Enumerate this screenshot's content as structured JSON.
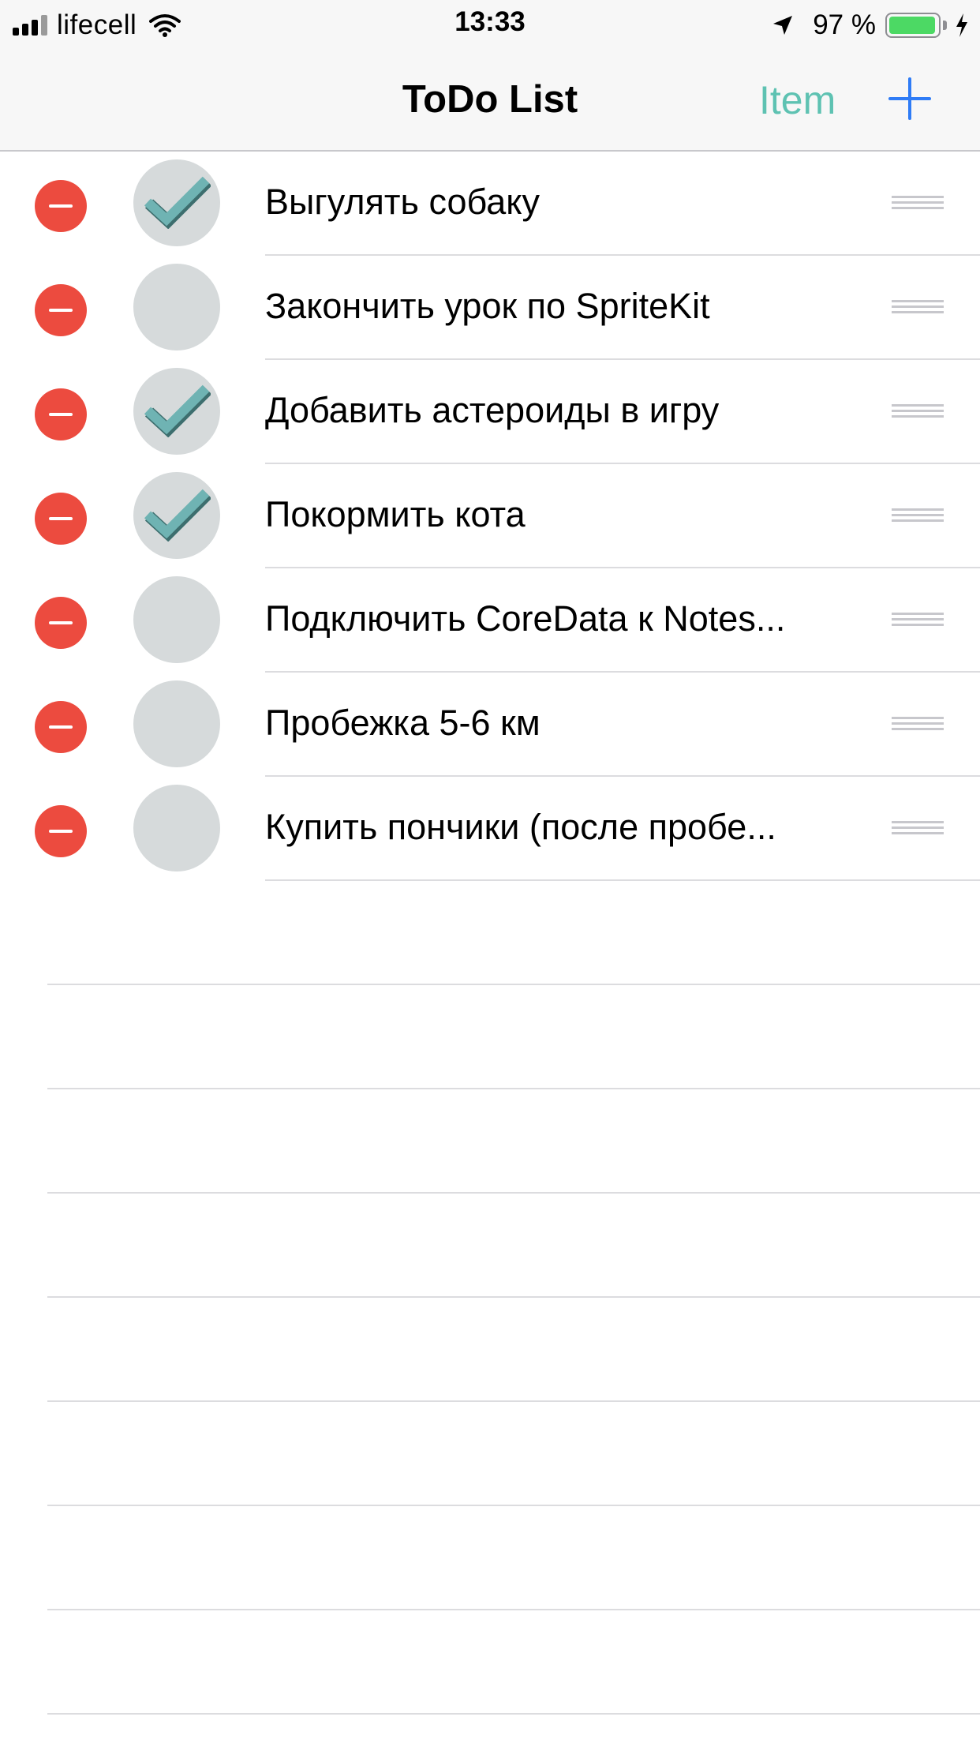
{
  "status_bar": {
    "carrier": "lifecell",
    "time": "13:33",
    "battery_percent": "97 %",
    "battery_level": 0.97
  },
  "nav": {
    "title": "ToDo List",
    "item_button": "Item",
    "add_icon": "plus-icon"
  },
  "colors": {
    "accent_blue": "#2f7cf6",
    "item_teal": "#5ec2b2",
    "delete_red": "#ec4b3f",
    "check_teal": "#6fb3b3"
  },
  "tasks": [
    {
      "title": "Выгулять собаку",
      "done": true
    },
    {
      "title": "Закончить урок по SpriteKit",
      "done": false
    },
    {
      "title": "Добавить астероиды в игру",
      "done": true
    },
    {
      "title": "Покормить кота",
      "done": true
    },
    {
      "title": "Подключить CoreData к Notes...",
      "done": false
    },
    {
      "title": "Пробежка 5-6 км",
      "done": false
    },
    {
      "title": "Купить пончики (после пробе...",
      "done": false
    }
  ]
}
